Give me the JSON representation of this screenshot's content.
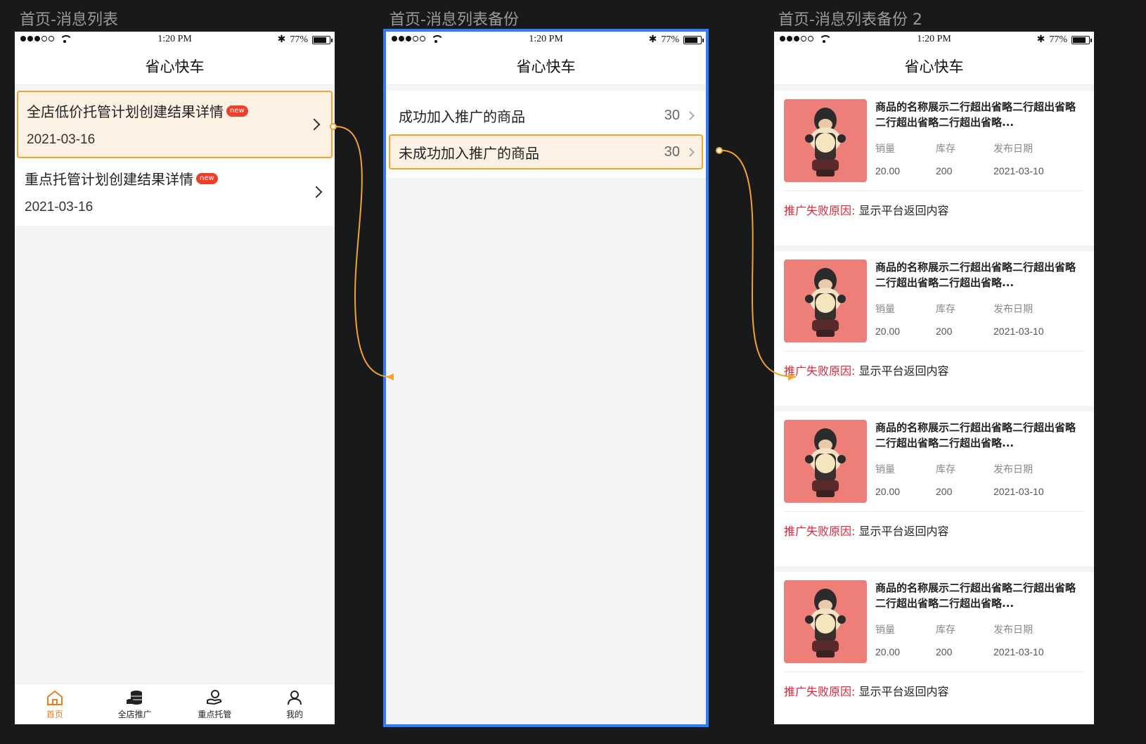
{
  "artboards": [
    {
      "title": "首页-消息列表"
    },
    {
      "title": "首页-消息列表备份"
    },
    {
      "title": "首页-消息列表备份 2"
    }
  ],
  "status": {
    "time": "1:20 PM",
    "battery": "77%",
    "bluetooth": "✱"
  },
  "app_title": "省心快车",
  "messages": [
    {
      "title": "全店低价托管计划创建结果详情",
      "badge": "new",
      "date": "2021-03-16"
    },
    {
      "title": "重点托管计划创建结果详情",
      "badge": "new",
      "date": "2021-03-16"
    }
  ],
  "tabs": [
    {
      "label": "首页",
      "icon": "home-icon"
    },
    {
      "label": "全店推广",
      "icon": "coins-icon"
    },
    {
      "label": "重点托管",
      "icon": "hand-coin-icon"
    },
    {
      "label": "我的",
      "icon": "user-icon"
    }
  ],
  "categories": [
    {
      "label": "成功加入推广的商品",
      "count": "30"
    },
    {
      "label": "未成功加入推广的商品",
      "count": "30"
    }
  ],
  "product": {
    "name": "商品的名称展示二行超出省略二行超出省略二行超出省略二行超出省略...",
    "stats": [
      {
        "label": "销量",
        "value": "20.00"
      },
      {
        "label": "库存",
        "value": "200"
      },
      {
        "label": "发布日期",
        "value": "2021-03-10"
      }
    ],
    "fail_label": "推广失败原因:",
    "fail_text": "显示平台返回内容"
  },
  "colors": {
    "accent": "#f07a20",
    "highlight_border": "#f3a42b",
    "selection": "#2f7cf6",
    "fail_red": "#e0263a"
  }
}
